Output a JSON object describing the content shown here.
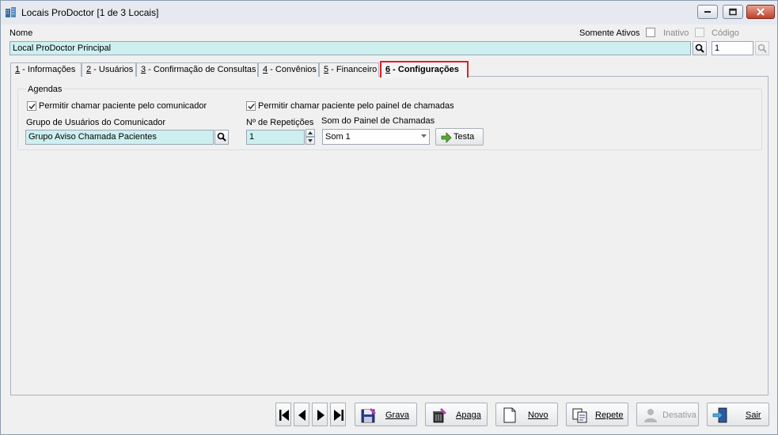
{
  "window": {
    "title": "Locais ProDoctor [1 de 3 Locais]"
  },
  "header": {
    "nome_label": "Nome",
    "nome_value": "Local ProDoctor Principal",
    "somente_ativos_label": "Somente Ativos",
    "inativo_label": "Inativo",
    "codigo_label": "Código",
    "codigo_value": "1"
  },
  "tabs": [
    {
      "num": "1",
      "label": " - Informações",
      "active": false
    },
    {
      "num": "2",
      "label": " - Usuários",
      "active": false
    },
    {
      "num": "3",
      "label": " - Confirmação de Consultas",
      "active": false
    },
    {
      "num": "4",
      "label": " - Convênios",
      "active": false
    },
    {
      "num": "5",
      "label": " - Financeiro",
      "active": false
    },
    {
      "num": "6",
      "label": " - Configurações",
      "active": true
    }
  ],
  "agendas": {
    "group_title": "Agendas",
    "chk_comunicador_label": "Permitir chamar paciente pelo comunicador",
    "chk_comunicador_checked": true,
    "chk_painel_label": "Permitir chamar paciente pelo painel de chamadas",
    "chk_painel_checked": true,
    "grupo_label": "Grupo de Usuários do Comunicador",
    "grupo_value": "Grupo Aviso Chamada Pacientes",
    "repeticoes_label": "Nº de Repetições",
    "repeticoes_value": "1",
    "som_label": "Som do Painel de Chamadas",
    "som_value": "Som 1",
    "testa_label": "Testa"
  },
  "toolbar": {
    "grava": "Grava",
    "apaga": "Apaga",
    "novo": "Novo",
    "repete": "Repete",
    "desativa": "Desativa",
    "sair": "Sair"
  },
  "colors": {
    "field_bg": "#cdeff0",
    "active_tab_border": "#e0202a"
  }
}
